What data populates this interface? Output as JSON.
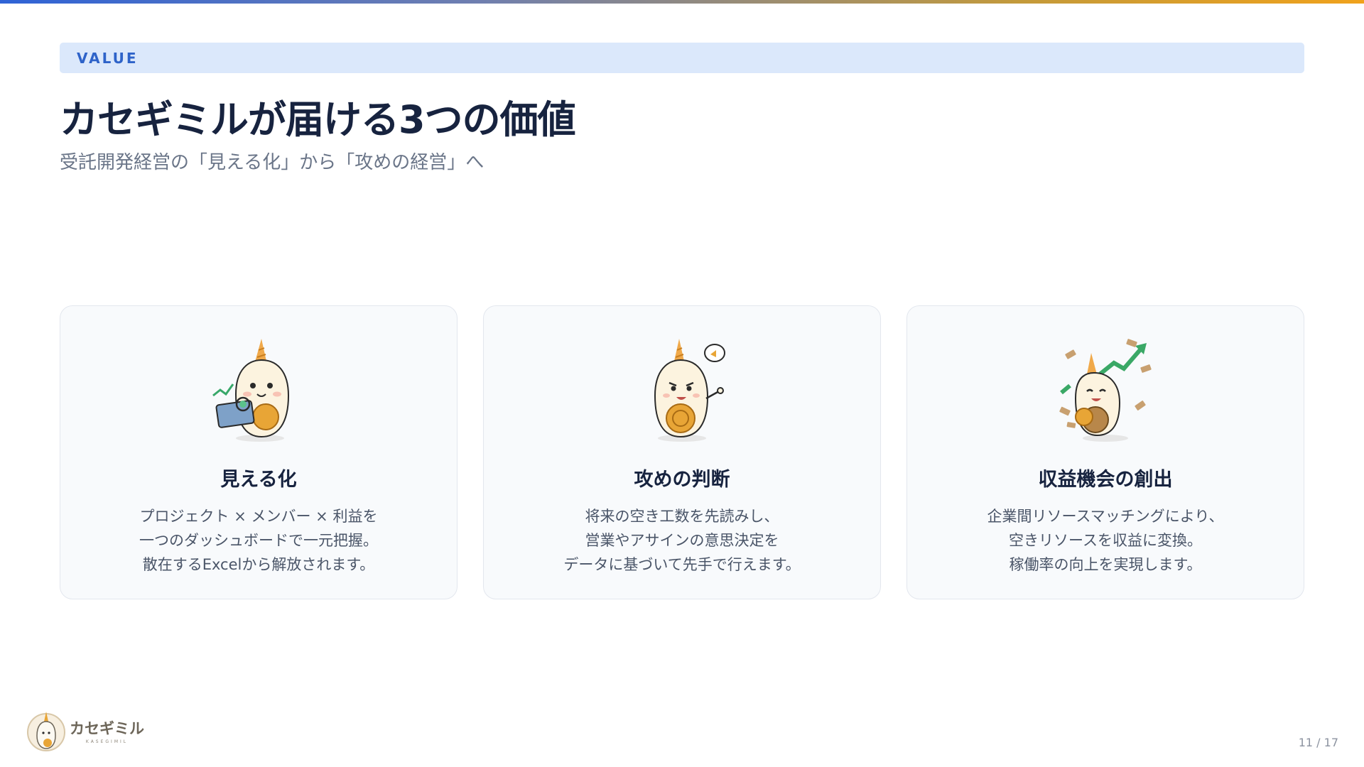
{
  "header": {
    "section_tag": "VALUE",
    "title": "カセギミルが届ける3つの価値",
    "subtitle": "受託開発経営の「見える化」から「攻めの経営」へ"
  },
  "cards": [
    {
      "icon": "mascot-tablet-chart-icon",
      "title": "見える化",
      "lines": [
        "プロジェクト × メンバー × 利益を",
        "一つのダッシュボードで一元把握。",
        "散在するExcelから解放されます。"
      ]
    },
    {
      "icon": "mascot-pointing-icon",
      "title": "攻めの判断",
      "lines": [
        "将来の空き工数を先読みし、",
        "営業やアサインの意思決定を",
        "データに基づいて先手で行えます。"
      ]
    },
    {
      "icon": "mascot-money-growth-icon",
      "title": "収益機会の創出",
      "lines": [
        "企業間リソースマッチングにより、",
        "空きリソースを収益に変換。",
        "稼働率の向上を実現します。"
      ]
    }
  ],
  "footer": {
    "brand_name": "カセギミル",
    "brand_sub": "KASEGIMIL",
    "page_number": "11 / 17"
  },
  "colors": {
    "accent": "#2e63c9",
    "tag_bg": "#dbe8fb",
    "title": "#17233f",
    "gradient_start": "#2f63d6",
    "gradient_end": "#f0a21c"
  }
}
